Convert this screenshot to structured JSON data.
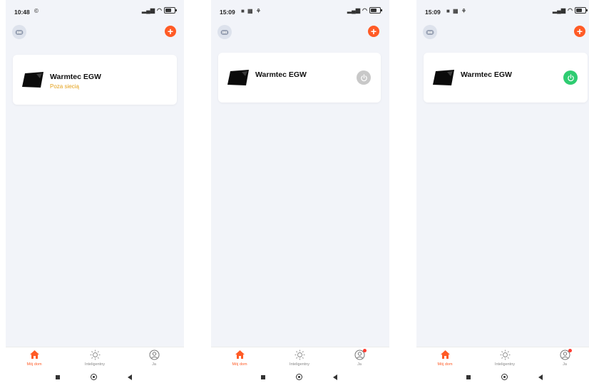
{
  "screens": [
    {
      "status_time": "10:48",
      "status_extra": "©",
      "device": {
        "name": "Warmtec EGW",
        "status": "Poza siecią",
        "power": "none"
      },
      "tabs": [
        {
          "label": "Mój dom"
        },
        {
          "label": "Inteligentny"
        },
        {
          "label": "Ja"
        }
      ]
    },
    {
      "status_time": "15:09",
      "status_extra": "■ ▦ ⚘",
      "device": {
        "name": "Warmtec EGW",
        "status": "",
        "power": "off"
      },
      "tabs": [
        {
          "label": "Mój dom"
        },
        {
          "label": "Inteligentny"
        },
        {
          "label": "Ja"
        }
      ]
    },
    {
      "status_time": "15:09",
      "status_extra": "■ ▦ ⚘",
      "device": {
        "name": "Warmtec EGW",
        "status": "",
        "power": "on"
      },
      "tabs": [
        {
          "label": "Mój dom"
        },
        {
          "label": "Inteligentny"
        },
        {
          "label": "Ja"
        }
      ]
    }
  ],
  "colors": {
    "accent": "#ff5b26",
    "offline_status": "#e4a11b",
    "power_off": "#c8c8c8",
    "power_on": "#2ecc71",
    "background": "#f2f4f9"
  },
  "icons": {
    "avatar": "home-avatar-icon",
    "add": "plus-icon",
    "power": "power-icon",
    "tab_home": "home-icon",
    "tab_smart": "sun-icon",
    "tab_me": "user-icon"
  }
}
